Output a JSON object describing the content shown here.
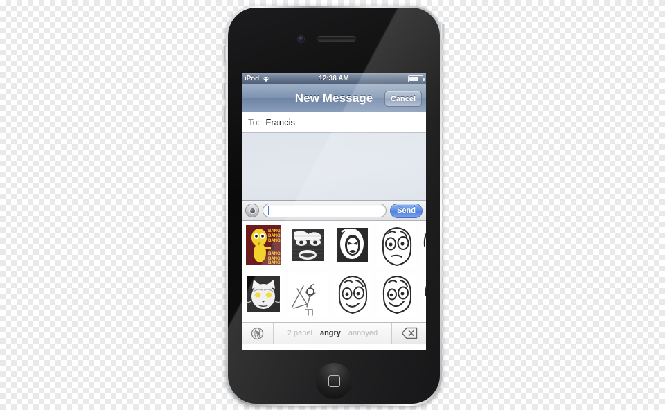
{
  "device": {
    "model_label": "iPhone 4",
    "hardware": {
      "front_camera": "front-camera",
      "earpiece": "earpiece-speaker",
      "home_button": "home-button",
      "mute_switch": "mute-switch",
      "volume_up": "volume-up-button",
      "volume_down": "volume-down-button",
      "power": "power-button"
    }
  },
  "status_bar": {
    "carrier": "iPod",
    "wifi_icon": "wifi-icon",
    "time": "12:38 AM",
    "battery_icon": "battery-icon",
    "battery_level_percent": 70,
    "background_color": "#61718a"
  },
  "nav_bar": {
    "title": "New Message",
    "cancel_label": "Cancel",
    "background_color": "#7e93b0"
  },
  "recipient_field": {
    "label": "To:",
    "value": "Francis",
    "placeholder": "To:"
  },
  "conversation": {
    "messages": [],
    "background_color": "#e1e6ed"
  },
  "compose_bar": {
    "camera_icon": "camera-icon",
    "input_value": "",
    "input_placeholder": "",
    "send_label": "Send",
    "send_color": "#4d81e0"
  },
  "sticker_panel": {
    "rows": [
      [
        {
          "name": "bang-bang-sticker",
          "alt": "BANG BANG yellow figure",
          "label": "BANG"
        },
        {
          "name": "grainy-rage-face-sticker",
          "alt": "grainy halftone rage face"
        },
        {
          "name": "angry-rage-face-sticker",
          "alt": "black and white angry rage face"
        },
        {
          "name": "surprised-face-sticker",
          "alt": "wide-eyed surprised face"
        },
        {
          "name": "dark-hair-face-sticker",
          "alt": "dark hair face partially visible"
        }
      ],
      [
        {
          "name": "cat-face-sticker",
          "alt": "white cat face with yellow eyes"
        },
        {
          "name": "stick-figure-sticker",
          "alt": "sketchy stick figure at desk"
        },
        {
          "name": "smiling-face-sticker",
          "alt": "smiling wide-eyed face"
        },
        {
          "name": "grinning-face-sticker",
          "alt": "grinning wide-eyed face"
        },
        {
          "name": "partial-face-sticker",
          "alt": "partially visible face"
        }
      ]
    ]
  },
  "category_bar": {
    "globe_icon": "globe-icon",
    "backspace_icon": "backspace-icon",
    "categories": [
      {
        "label": "2 panel",
        "selected": false
      },
      {
        "label": "angry",
        "selected": true
      },
      {
        "label": "annoyed",
        "selected": false
      }
    ]
  }
}
